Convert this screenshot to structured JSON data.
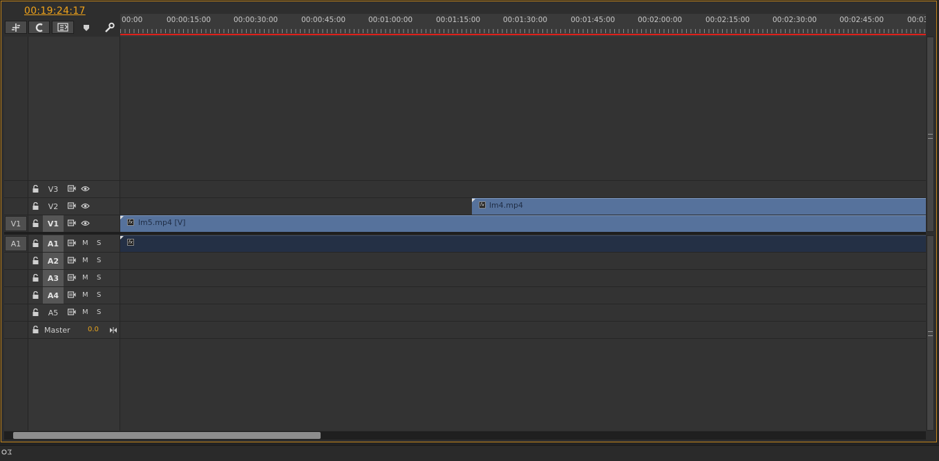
{
  "timecode": "00:19:24:17",
  "toolbar": {
    "buttons": [
      "snap-button",
      "linked-selection-button",
      "add-marker-button",
      "marker-icon",
      "settings-wrench-icon"
    ]
  },
  "ruler": {
    "labels": [
      "00:00",
      "00:00:15:00",
      "00:00:30:00",
      "00:00:45:00",
      "00:01:00:00",
      "00:01:15:00",
      "00:01:30:00",
      "00:01:45:00",
      "00:02:00:00",
      "00:02:15:00",
      "00:02:30:00",
      "00:02:45:00",
      "00:03"
    ]
  },
  "video_tracks": [
    {
      "name": "V3",
      "active": false,
      "source": ""
    },
    {
      "name": "V2",
      "active": false,
      "source": ""
    },
    {
      "name": "V1",
      "active": true,
      "source": "V1"
    }
  ],
  "audio_tracks": [
    {
      "name": "A1",
      "active": true,
      "source": "A1",
      "mute": "M",
      "solo": "S"
    },
    {
      "name": "A2",
      "active": true,
      "source": "",
      "mute": "M",
      "solo": "S"
    },
    {
      "name": "A3",
      "active": true,
      "source": "",
      "mute": "M",
      "solo": "S"
    },
    {
      "name": "A4",
      "active": true,
      "source": "",
      "mute": "M",
      "solo": "S"
    },
    {
      "name": "A5",
      "active": false,
      "source": "",
      "mute": "M",
      "solo": "S"
    }
  ],
  "master": {
    "label": "Master",
    "volume": "0.0"
  },
  "clips": {
    "v2": {
      "name": "lm4.mp4",
      "fx": "fx"
    },
    "v1": {
      "name": "lm5.mp4 [V]",
      "fx": "fx"
    },
    "a1": {
      "name": "",
      "fx": "fx"
    }
  }
}
